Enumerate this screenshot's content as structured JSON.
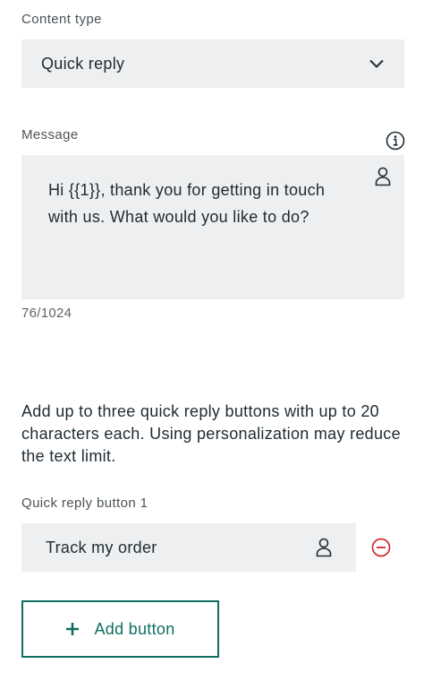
{
  "content_type": {
    "label": "Content type",
    "selected": "Quick reply",
    "icon": "chevron-down-icon"
  },
  "message": {
    "label": "Message",
    "text": "Hi {{1}}, thank you for getting in touch with us. What would you like to do?",
    "counter": "76/1024",
    "info_icon": "info-icon",
    "personalize_icon": "person-icon"
  },
  "quick_reply": {
    "hint": "Add up to three quick reply buttons with up to 20 characters each. Using personalization may reduce the text limit.",
    "buttons": [
      {
        "label": "Quick reply button 1",
        "value": "Track my order"
      }
    ],
    "add_button_label": "Add button"
  },
  "colors": {
    "accent": "#0f6e61",
    "danger": "#d0282e",
    "field_bg": "#eeeff0",
    "text": "#1d2b33"
  }
}
